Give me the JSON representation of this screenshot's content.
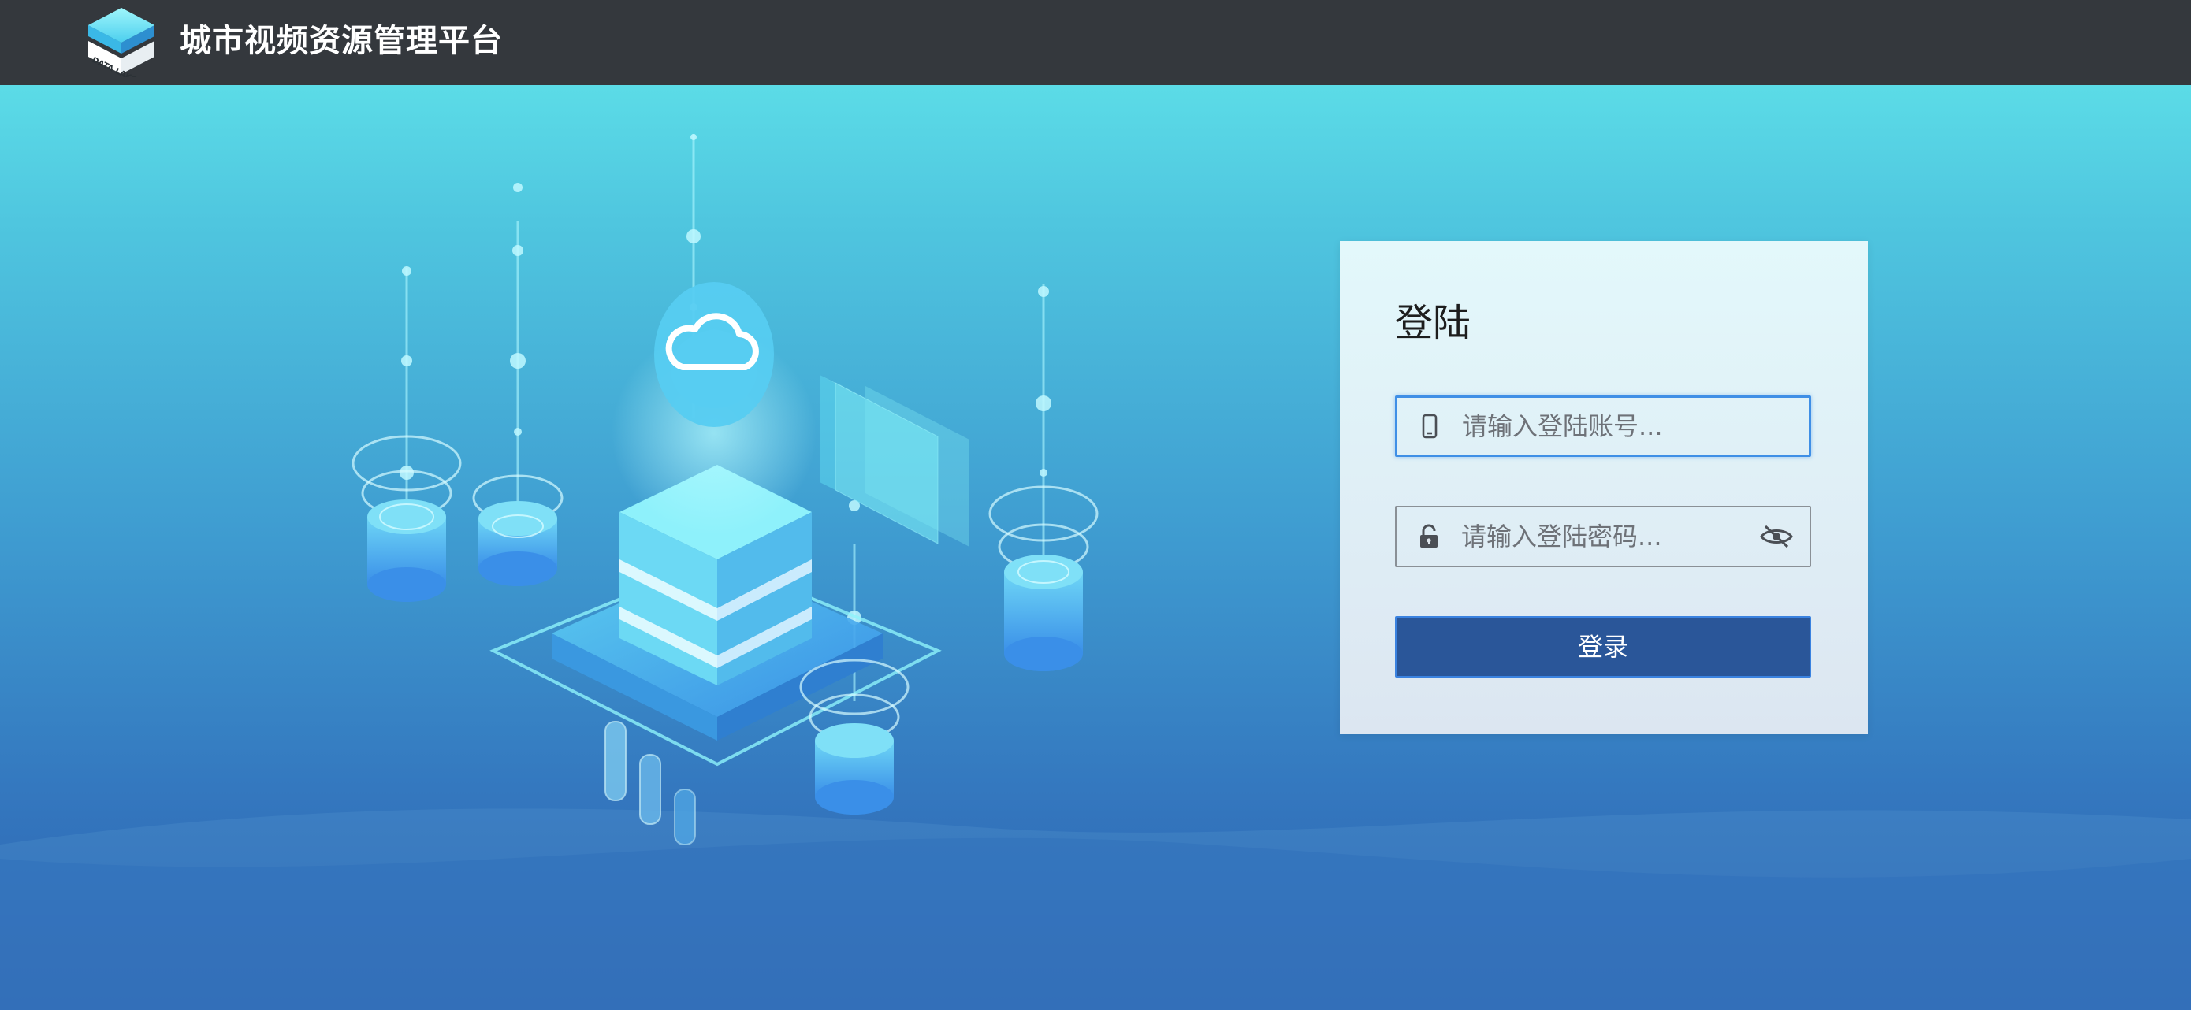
{
  "header": {
    "title": "城市视频资源管理平台",
    "logo_text": "DATA LAKE"
  },
  "login": {
    "title": "登陆",
    "account_placeholder": "请输入登陆账号...",
    "account_value": "",
    "password_placeholder": "请输入登陆密码...",
    "password_value": "",
    "submit_label": "登录"
  },
  "icons": {
    "account_icon": "mobile-phone-icon",
    "password_icon": "unlock-icon",
    "toggle_icon": "eye-hidden-icon",
    "illustration_icon": "cloud-icon"
  },
  "colors": {
    "topbar": "#34383d",
    "button": "#2a5699",
    "focus_border": "#3f8fe6",
    "background_top": "#63e9ec",
    "background_bottom": "#2c5fae"
  }
}
